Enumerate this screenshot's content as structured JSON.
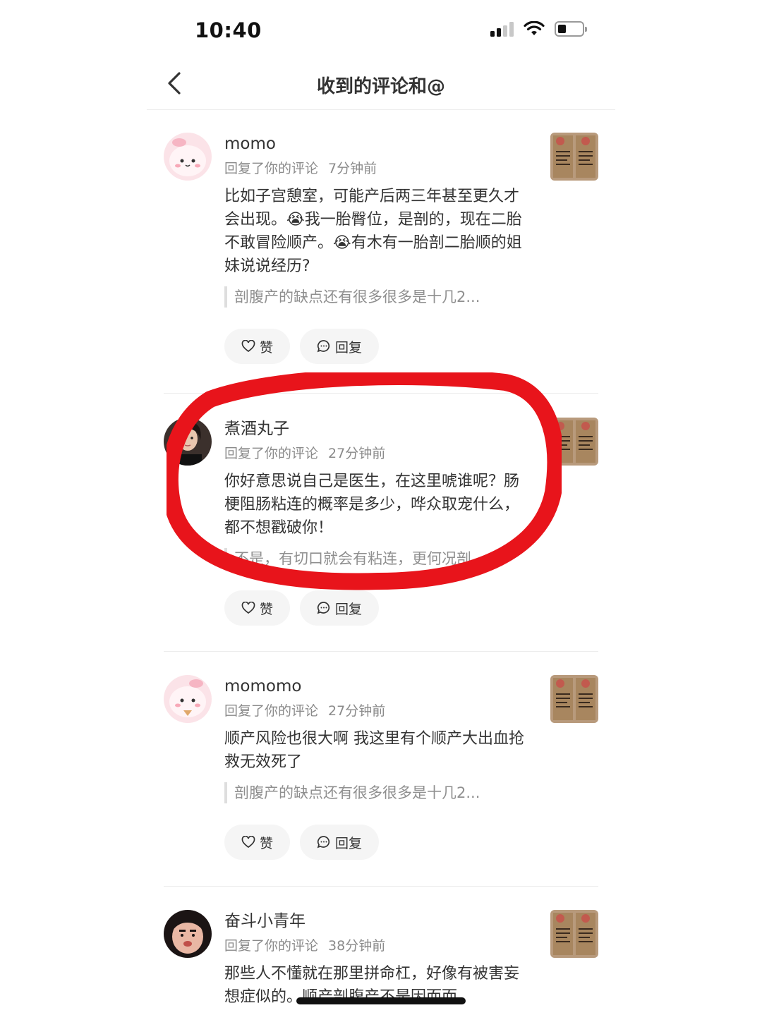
{
  "status_bar": {
    "time": "10:40"
  },
  "header": {
    "title": "收到的评论和@"
  },
  "comments": [
    {
      "username": "momo",
      "action": "回复了你的评论",
      "time": "7分钟前",
      "content": "比如子宫憩室，可能产后两三年甚至更久才会出现。😭我一胎臀位，是剖的，现在二胎不敢冒险顺产。😭有木有一胎剖二胎顺的姐妹说说经历?",
      "quote": "剖腹产的缺点还有很多很多是十几2...",
      "like_label": "赞",
      "reply_label": "回复"
    },
    {
      "username": "煮酒丸子",
      "action": "回复了你的评论",
      "time": "27分钟前",
      "content": "你好意思说自己是医生，在这里唬谁呢？肠梗阻肠粘连的概率是多少，哗众取宠什么，都不想戳破你！",
      "quote": "不是，有切口就会有粘连，更何况剖...",
      "like_label": "赞",
      "reply_label": "回复"
    },
    {
      "username": "momomo",
      "action": "回复了你的评论",
      "time": "27分钟前",
      "content": "顺产风险也很大啊 我这里有个顺产大出血抢救无效死了",
      "quote": "剖腹产的缺点还有很多很多是十几2...",
      "like_label": "赞",
      "reply_label": "回复"
    },
    {
      "username": "奋斗小青年",
      "action": "回复了你的评论",
      "time": "38分钟前",
      "content": "那些人不懂就在那里拼命杠，好像有被害妄想症似的。顺产剖腹产不是因而而"
    }
  ],
  "colors": {
    "annotation": "#e8141b",
    "meta_text": "#8a8a8a"
  }
}
